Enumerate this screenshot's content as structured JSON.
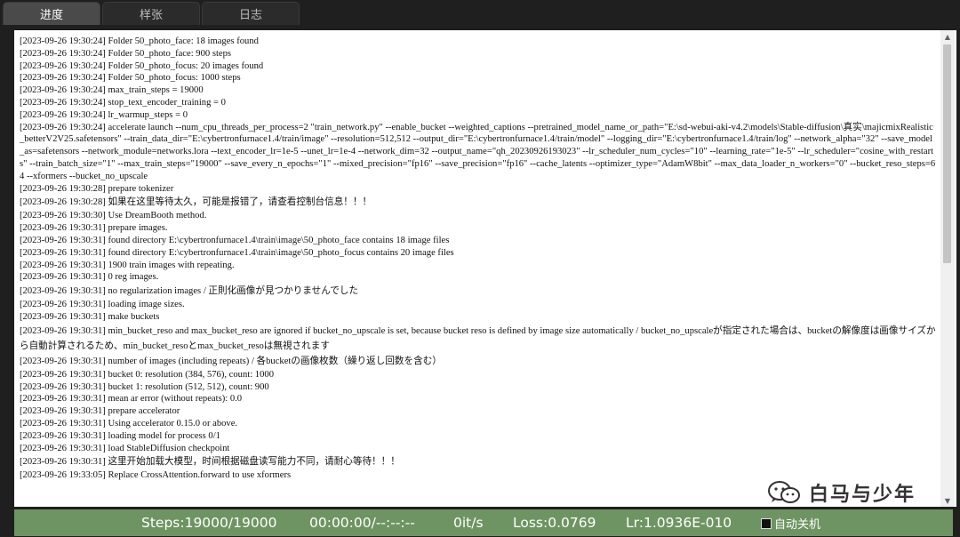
{
  "tabs": [
    {
      "label": "进度",
      "active": true
    },
    {
      "label": "样张",
      "active": false
    },
    {
      "label": "日志",
      "active": false
    }
  ],
  "log_lines": [
    "[2023-09-26 19:30:24] Folder 50_photo_face: 18 images found",
    "[2023-09-26 19:30:24] Folder 50_photo_face: 900 steps",
    "[2023-09-26 19:30:24] Folder 50_photo_focus: 20 images found",
    "[2023-09-26 19:30:24] Folder 50_photo_focus: 1000 steps",
    "[2023-09-26 19:30:24] max_train_steps = 19000",
    "[2023-09-26 19:30:24] stop_text_encoder_training = 0",
    "[2023-09-26 19:30:24] lr_warmup_steps = 0",
    "[2023-09-26 19:30:24] accelerate launch --num_cpu_threads_per_process=2 \"train_network.py\" --enable_bucket --weighted_captions --pretrained_model_name_or_path=\"E:\\sd-webui-aki-v4.2\\models\\Stable-diffusion\\真实\\majicmixRealistic_betterV2V25.safetensors\" --train_data_dir=\"E:\\cybertronfurnace1.4/train/image\" --resolution=512,512 --output_dir=\"E:\\cybertronfurnace1.4/train/model\" --logging_dir=\"E:\\cybertronfurnace1.4/train/log\" --network_alpha=\"32\" --save_model_as=safetensors --network_module=networks.lora --text_encoder_lr=1e-5 --unet_lr=1e-4 --network_dim=32 --output_name=\"qh_20230926193023\" --lr_scheduler_num_cycles=\"10\" --learning_rate=\"1e-5\" --lr_scheduler=\"cosine_with_restarts\" --train_batch_size=\"1\" --max_train_steps=\"19000\" --save_every_n_epochs=\"1\" --mixed_precision=\"fp16\" --save_precision=\"fp16\" --cache_latents --optimizer_type=\"AdamW8bit\" --max_data_loader_n_workers=\"0\" --bucket_reso_steps=64 --xformers --bucket_no_upscale",
    "[2023-09-26 19:30:28] prepare tokenizer",
    "[2023-09-26 19:30:28] 如果在这里等待太久，可能是报错了，请查看控制台信息！！！",
    "[2023-09-26 19:30:30] Use DreamBooth method.",
    "[2023-09-26 19:30:31] prepare images.",
    "[2023-09-26 19:30:31] found directory E:\\cybertronfurnace1.4\\train\\image\\50_photo_face contains 18 image files",
    "[2023-09-26 19:30:31] found directory E:\\cybertronfurnace1.4\\train\\image\\50_photo_focus contains 20 image files",
    "[2023-09-26 19:30:31] 1900 train images with repeating.",
    "[2023-09-26 19:30:31] 0 reg images.",
    "[2023-09-26 19:30:31] no regularization images / 正則化画像が見つかりませんでした",
    "[2023-09-26 19:30:31] loading image sizes.",
    "[2023-09-26 19:30:31] make buckets",
    "[2023-09-26 19:30:31] min_bucket_reso and max_bucket_reso are ignored if bucket_no_upscale is set, because bucket reso is defined by image size automatically / bucket_no_upscaleが指定された場合は、bucketの解像度は画像サイズから自動計算されるため、min_bucket_resoとmax_bucket_resoは無視されます",
    "[2023-09-26 19:30:31] number of images (including repeats) / 各bucketの画像枚数（繰り返し回数を含む）",
    "[2023-09-26 19:30:31] bucket 0: resolution (384, 576), count: 1000",
    "[2023-09-26 19:30:31] bucket 1: resolution (512, 512), count: 900",
    "[2023-09-26 19:30:31] mean ar error (without repeats): 0.0",
    "[2023-09-26 19:30:31] prepare accelerator",
    "[2023-09-26 19:30:31] Using accelerator 0.15.0 or above.",
    "[2023-09-26 19:30:31] loading model for process 0/1",
    "[2023-09-26 19:30:31] load StableDiffusion checkpoint",
    "[2023-09-26 19:30:31] 这里开始加载大模型，时间根据磁盘读写能力不同，请耐心等待！！！",
    "[2023-09-26 19:33:05] Replace CrossAttention.forward to use xformers"
  ],
  "watermark": {
    "icon": "wechat-icon",
    "text": "白马与少年"
  },
  "status": {
    "steps": "Steps:19000/19000",
    "time": "00:00:00/--:--:--",
    "speed": "0it/s",
    "loss": "Loss:0.0769",
    "lr": "Lr:1.0936E-010",
    "auto_shutdown_label": "自动关机",
    "auto_shutdown_checked": false
  },
  "colors": {
    "status_bar": "#6f9463",
    "active_tab": "#4a4a4a",
    "background": "#1f1f1f"
  }
}
